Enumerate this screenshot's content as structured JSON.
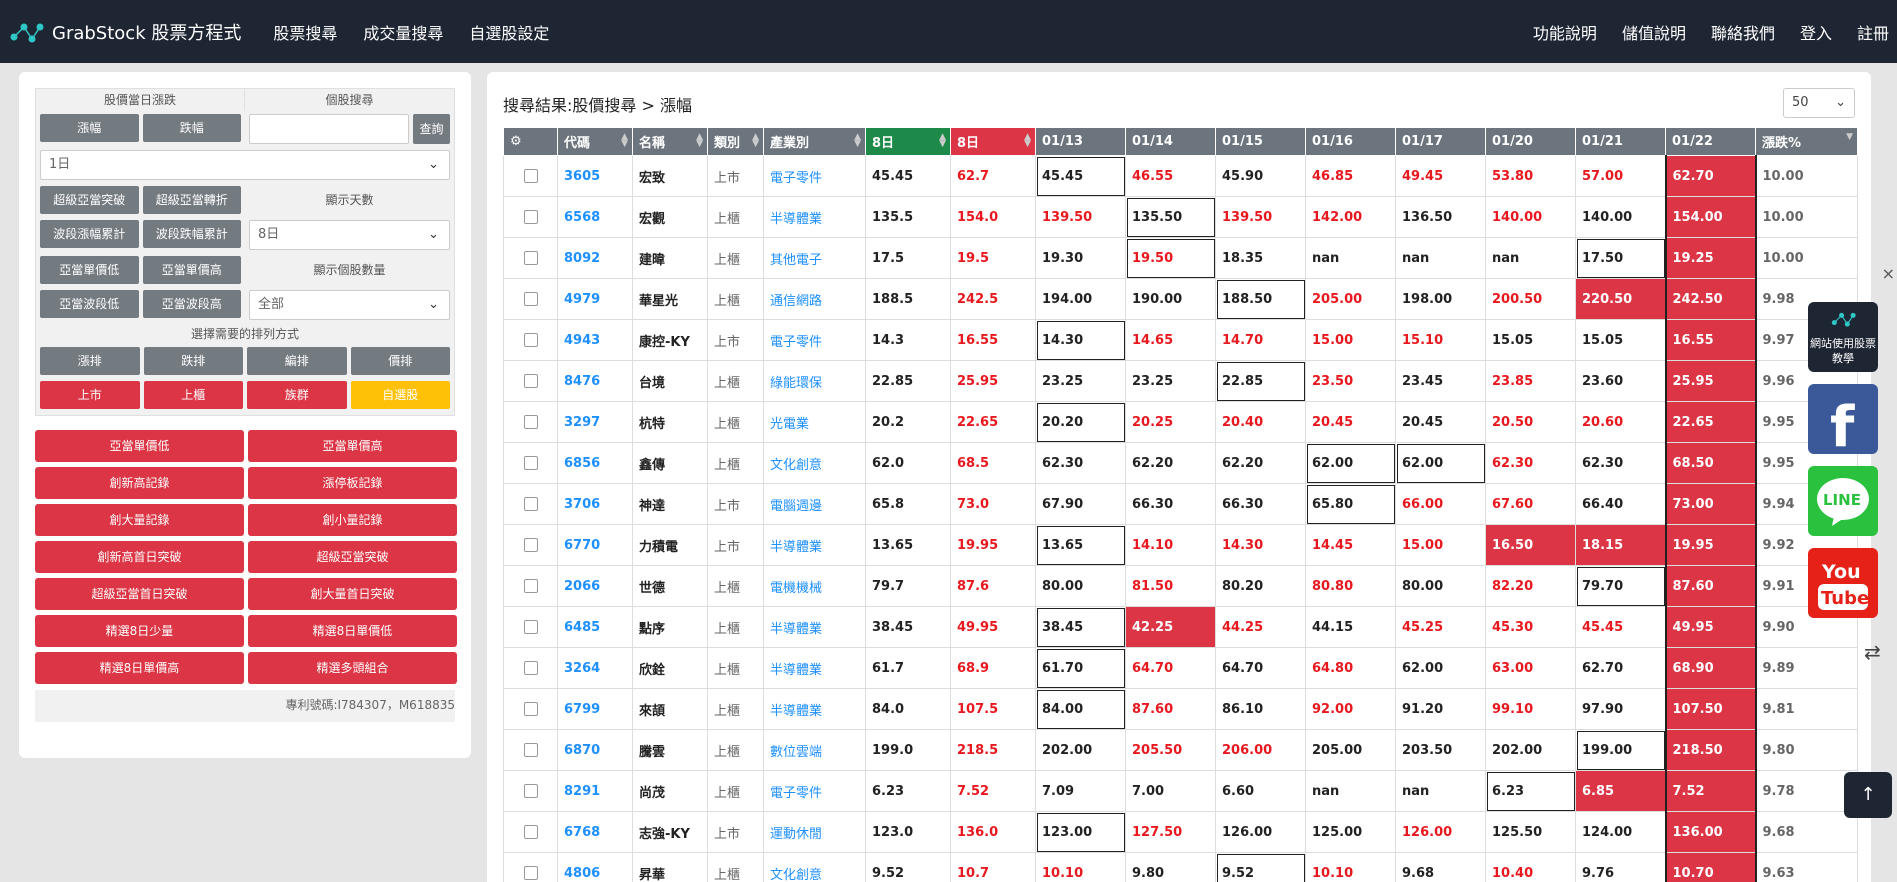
{
  "nav": {
    "brand": "GrabStock 股票方程式",
    "left": [
      "股票搜尋",
      "成交量搜尋",
      "自選股設定"
    ],
    "right": [
      "功能說明",
      "儲值說明",
      "聯絡我們",
      "登入",
      "註冊"
    ]
  },
  "left": {
    "h_daily": "股價當日漲跌",
    "h_search": "個股搜尋",
    "btn_up": "漲幅",
    "btn_down": "跌幅",
    "search_placeholder": "",
    "btn_query": "查詢",
    "period_select": "1日",
    "btns_a": [
      "超級亞當突破",
      "超級亞當轉折"
    ],
    "label_days": "顯示天數",
    "btns_b": [
      "波段漲幅累計",
      "波段跌幅累計"
    ],
    "days_select": "8日",
    "btns_c": [
      "亞當單價低",
      "亞當單價高"
    ],
    "label_count": "顯示個股數量",
    "btns_d": [
      "亞當波段低",
      "亞當波段高"
    ],
    "count_select": "全部",
    "label_sort": "選擇需要的排列方式",
    "sort_btns": [
      "漲排",
      "跌排",
      "編排",
      "價排"
    ],
    "market_btns": [
      "上市",
      "上櫃",
      "族群",
      "自選股"
    ],
    "big_btns": [
      "亞當單價低",
      "亞當單價高",
      "創新高記錄",
      "漲停板記錄",
      "創大量記錄",
      "創小量記錄",
      "創新高首日突破",
      "超級亞當突破",
      "超級亞當首日突破",
      "創大量首日突破",
      "精選8日少量",
      "精選8日單價低",
      "精選8日單價高",
      "精選多頭組合"
    ],
    "patent": "專利號碼:I784307，M618835"
  },
  "right": {
    "title": "搜尋結果:股價搜尋 > 漲幅",
    "per_page": "50",
    "headers": [
      "代碼",
      "名稱",
      "類別",
      "產業別",
      "8日",
      "8日",
      "01/13",
      "01/14",
      "01/15",
      "01/16",
      "01/17",
      "01/20",
      "01/21",
      "01/22",
      "漲跌%"
    ],
    "rows": [
      [
        "3605",
        "宏致",
        "上市",
        "電子零件",
        "45.45",
        "62.7",
        "45.45",
        "46.55",
        "45.90",
        "46.85",
        "49.45",
        "53.80",
        "57.00",
        "62.70",
        "10.00"
      ],
      [
        "6568",
        "宏觀",
        "上櫃",
        "半導體業",
        "135.5",
        "154.0",
        "139.50",
        "135.50",
        "139.50",
        "142.00",
        "136.50",
        "140.00",
        "140.00",
        "154.00",
        "10.00"
      ],
      [
        "8092",
        "建暐",
        "上櫃",
        "其他電子",
        "17.5",
        "19.5",
        "19.30",
        "19.50",
        "18.35",
        "nan",
        "nan",
        "nan",
        "17.50",
        "19.25",
        "10.00"
      ],
      [
        "4979",
        "華星光",
        "上櫃",
        "通信網路",
        "188.5",
        "242.5",
        "194.00",
        "190.00",
        "188.50",
        "205.00",
        "198.00",
        "200.50",
        "220.50",
        "242.50",
        "9.98"
      ],
      [
        "4943",
        "康控-KY",
        "上市",
        "電子零件",
        "14.3",
        "16.55",
        "14.30",
        "14.65",
        "14.70",
        "15.00",
        "15.10",
        "15.05",
        "15.05",
        "16.55",
        "9.97"
      ],
      [
        "8476",
        "台境",
        "上櫃",
        "綠能環保",
        "22.85",
        "25.95",
        "23.25",
        "23.25",
        "22.85",
        "23.50",
        "23.45",
        "23.85",
        "23.60",
        "25.95",
        "9.96"
      ],
      [
        "3297",
        "杭特",
        "上櫃",
        "光電業",
        "20.2",
        "22.65",
        "20.20",
        "20.25",
        "20.40",
        "20.45",
        "20.45",
        "20.50",
        "20.60",
        "22.65",
        "9.95"
      ],
      [
        "6856",
        "鑫傳",
        "上櫃",
        "文化創意",
        "62.0",
        "68.5",
        "62.30",
        "62.20",
        "62.20",
        "62.00",
        "62.00",
        "62.30",
        "62.30",
        "68.50",
        "9.95"
      ],
      [
        "3706",
        "神達",
        "上市",
        "電腦週邊",
        "65.8",
        "73.0",
        "67.90",
        "66.30",
        "66.30",
        "65.80",
        "66.00",
        "67.60",
        "66.40",
        "73.00",
        "9.94"
      ],
      [
        "6770",
        "力積電",
        "上市",
        "半導體業",
        "13.65",
        "19.95",
        "13.65",
        "14.10",
        "14.30",
        "14.45",
        "15.00",
        "16.50",
        "18.15",
        "19.95",
        "9.92"
      ],
      [
        "2066",
        "世德",
        "上櫃",
        "電機機械",
        "79.7",
        "87.6",
        "80.00",
        "81.50",
        "80.20",
        "80.80",
        "80.00",
        "82.20",
        "79.70",
        "87.60",
        "9.91"
      ],
      [
        "6485",
        "點序",
        "上櫃",
        "半導體業",
        "38.45",
        "49.95",
        "38.45",
        "42.25",
        "44.25",
        "44.15",
        "45.25",
        "45.30",
        "45.45",
        "49.95",
        "9.90"
      ],
      [
        "3264",
        "欣銓",
        "上櫃",
        "半導體業",
        "61.7",
        "68.9",
        "61.70",
        "64.70",
        "64.70",
        "64.80",
        "62.00",
        "63.00",
        "62.70",
        "68.90",
        "9.89"
      ],
      [
        "6799",
        "來頡",
        "上櫃",
        "半導體業",
        "84.0",
        "107.5",
        "84.00",
        "87.60",
        "86.10",
        "92.00",
        "91.20",
        "99.10",
        "97.90",
        "107.50",
        "9.81"
      ],
      [
        "6870",
        "騰雲",
        "上櫃",
        "數位雲端",
        "199.0",
        "218.5",
        "202.00",
        "205.50",
        "206.00",
        "205.00",
        "203.50",
        "202.00",
        "199.00",
        "218.50",
        "9.80"
      ],
      [
        "8291",
        "尚茂",
        "上櫃",
        "電子零件",
        "6.23",
        "7.52",
        "7.09",
        "7.00",
        "6.60",
        "nan",
        "nan",
        "6.23",
        "6.85",
        "7.52",
        "9.78"
      ],
      [
        "6768",
        "志強-KY",
        "上市",
        "運動休閒",
        "123.0",
        "136.0",
        "123.00",
        "127.50",
        "126.00",
        "125.00",
        "126.00",
        "125.50",
        "124.00",
        "136.00",
        "9.68"
      ],
      [
        "4806",
        "昇華",
        "上櫃",
        "文化創意",
        "9.52",
        "10.7",
        "10.10",
        "9.80",
        "9.52",
        "10.10",
        "9.68",
        "10.40",
        "9.76",
        "10.70",
        "9.63"
      ]
    ]
  },
  "float": {
    "teach": "網站使用股票教學",
    "close": "×",
    "swap": "⇄",
    "top": "↑"
  },
  "colors": {
    "red": "#dc3545",
    "green": "#1e8a4a",
    "nav": "#1e2633",
    "gray_btn": "#737a80"
  }
}
